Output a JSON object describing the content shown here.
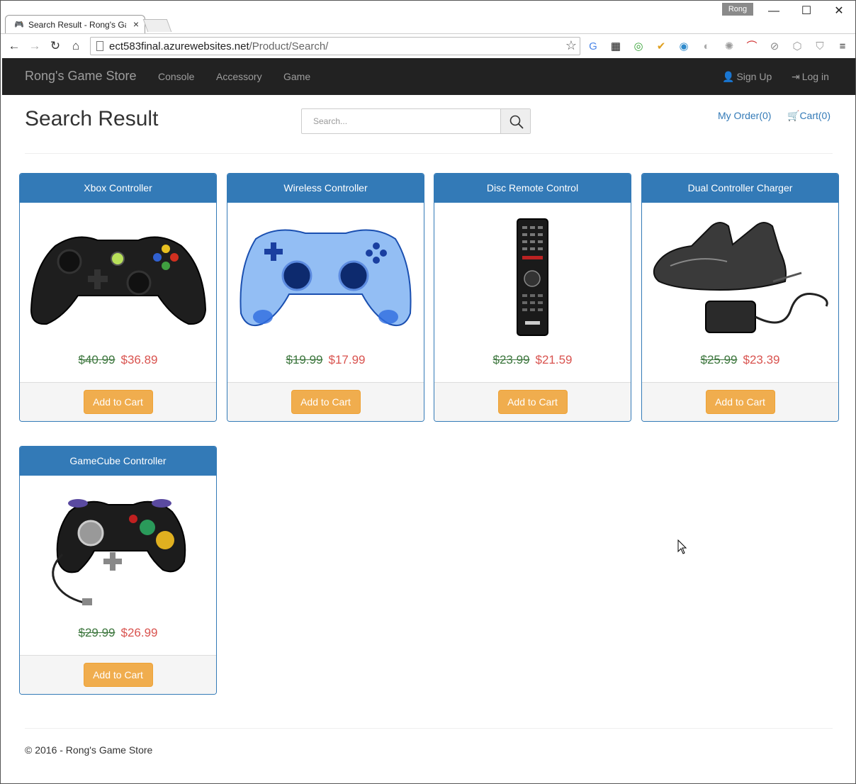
{
  "browser": {
    "tab_title": "Search Result - Rong's Ga",
    "user_badge": "Rong",
    "url_host": "ect583final.azurewebsites.net",
    "url_path": "/Product/Search/"
  },
  "nav": {
    "brand": "Rong's Game Store",
    "links": [
      "Console",
      "Accessory",
      "Game"
    ],
    "sign_up": "Sign Up",
    "log_in": "Log in"
  },
  "page": {
    "title": "Search Result",
    "search_placeholder": "Search...",
    "my_order": "My Order(0)",
    "cart": "Cart(0)"
  },
  "products": [
    {
      "name": "Xbox Controller",
      "old_price": "$40.99",
      "new_price": "$36.89",
      "button": "Add to Cart",
      "image": "xbox-controller"
    },
    {
      "name": "Wireless Controller",
      "old_price": "$19.99",
      "new_price": "$17.99",
      "button": "Add to Cart",
      "image": "wireless-controller"
    },
    {
      "name": "Disc Remote Control",
      "old_price": "$23.99",
      "new_price": "$21.59",
      "button": "Add to Cart",
      "image": "remote-control"
    },
    {
      "name": "Dual Controller Charger",
      "old_price": "$25.99",
      "new_price": "$23.39",
      "button": "Add to Cart",
      "image": "charger"
    },
    {
      "name": "GameCube Controller",
      "old_price": "$29.99",
      "new_price": "$26.99",
      "button": "Add to Cart",
      "image": "gamecube-controller"
    }
  ],
  "footer": {
    "text": "© 2016 - Rong's Game Store"
  },
  "colors": {
    "primary": "#337ab7",
    "warning": "#f0ad4e",
    "navbar": "#222222",
    "old_price": "#3c763d",
    "new_price": "#d9534f"
  }
}
